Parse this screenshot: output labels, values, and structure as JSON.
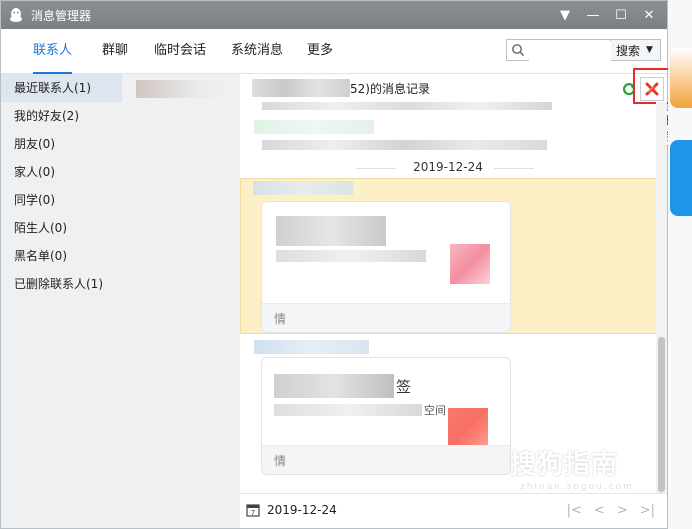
{
  "window": {
    "title": "消息管理器",
    "controls": [
      "▼",
      "—",
      "☐",
      "✕"
    ]
  },
  "nav": {
    "tabs": [
      "联系人",
      "群聊",
      "临时会话",
      "系统消息",
      "更多"
    ],
    "active_tab": "联系人",
    "search_placeholder": "",
    "search_button": "搜索"
  },
  "sidebar": {
    "items": [
      "最近联系人(1)",
      "我的好友(2)",
      "朋友(0)",
      "家人(0)",
      "同学(0)",
      "陌生人(0)",
      "黑名单(0)",
      "已删除联系人(1)"
    ]
  },
  "messages": {
    "header_suffix": "52)的消息记录",
    "delete_tooltip": "删除",
    "date_separator": "2019-12-24",
    "card1_foot": "情",
    "card2_title_tail": "签",
    "card2_side": "空间",
    "card2_foot": "情",
    "footer_date": "2019-12-24"
  },
  "watermark": {
    "main": "搜狗指南",
    "sub": "zhinan.sogou.com"
  },
  "colors": {
    "accent": "#1a79d6",
    "highlight": "#fdefc6",
    "annotation": "#e62b2b"
  }
}
